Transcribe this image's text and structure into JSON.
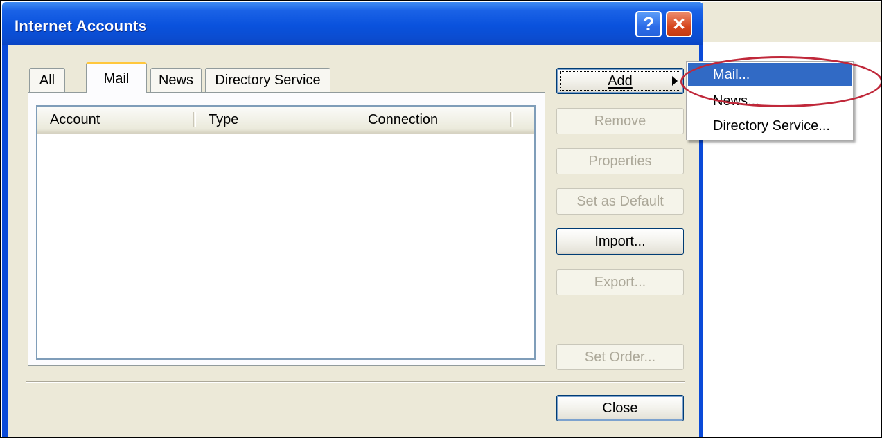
{
  "window": {
    "title": "Internet Accounts",
    "help_button": "?",
    "close_button": "✕"
  },
  "tabs": [
    {
      "label": "All",
      "active": false
    },
    {
      "label": "Mail",
      "active": true
    },
    {
      "label": "News",
      "active": false
    },
    {
      "label": "Directory Service",
      "active": false
    }
  ],
  "list": {
    "columns": [
      "Account",
      "Type",
      "Connection"
    ],
    "rows": []
  },
  "buttons": {
    "add": "Add",
    "remove": "Remove",
    "properties": "Properties",
    "set_default": "Set as Default",
    "import": "Import...",
    "export": "Export...",
    "set_order": "Set Order...",
    "close": "Close"
  },
  "add_menu": {
    "items": [
      "Mail...",
      "News...",
      "Directory Service..."
    ],
    "selected": "Mail..."
  },
  "colors": {
    "titlebar": "#0a52dd",
    "client_bg": "#ece9d8",
    "menu_selected": "#316ac5",
    "annotation": "#c0283a"
  }
}
